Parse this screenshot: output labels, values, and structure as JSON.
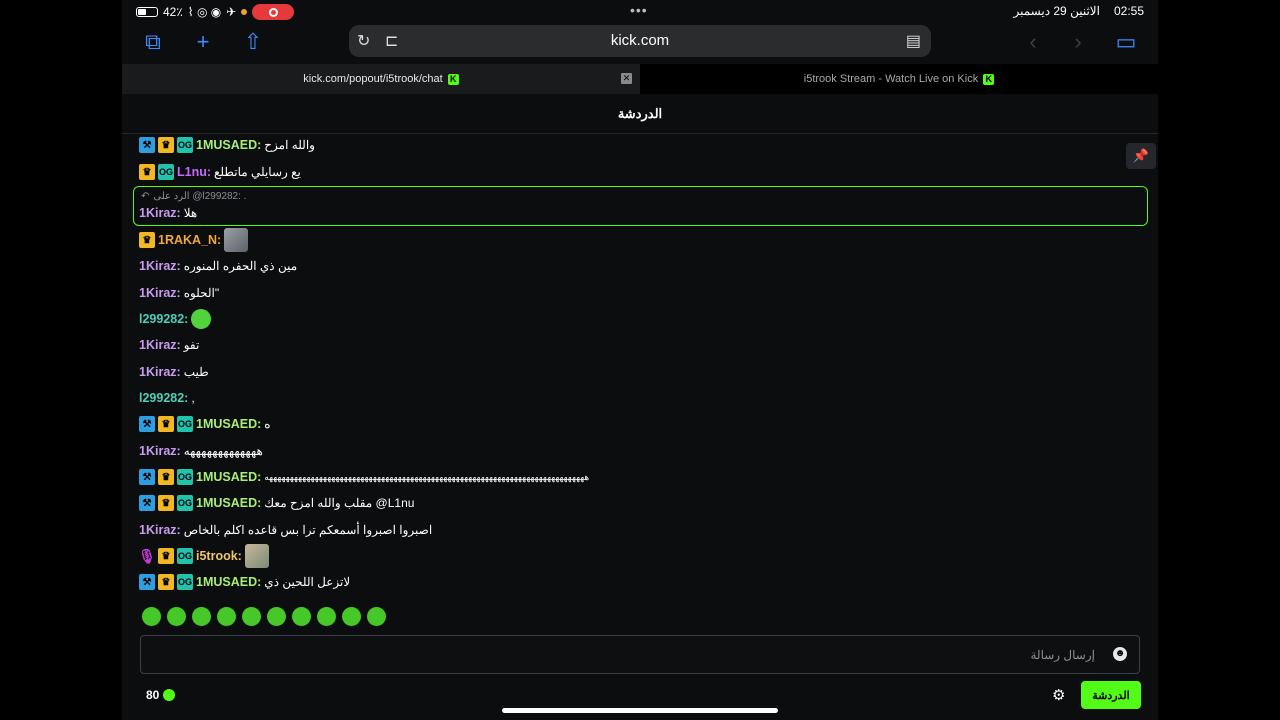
{
  "status": {
    "battery_pct": "42٪",
    "date": "الاثنين 29 ديسمبر",
    "time": "02:55"
  },
  "browser": {
    "url": "kick.com",
    "tabs": [
      {
        "label": "kick.com/popout/i5trook/chat",
        "close": "✕"
      },
      {
        "label": "i5trook Stream - Watch Live on Kick"
      }
    ]
  },
  "chat": {
    "title": "الدردشة",
    "reply_ref": "الرد على @l299282: .",
    "messages": [
      {
        "user": "1MUSAED:",
        "user_color": "#a8ef77",
        "text": "والله امزح"
      },
      {
        "user": "L1nu:",
        "user_color": "#c36bff",
        "text": "يع رسايلي ماتطلع"
      },
      {
        "user": "1Kiraz:",
        "user_color": "#c89bf0",
        "text": "هلا"
      },
      {
        "user": "1RAKA_N:",
        "user_color": "#f0a73c",
        "text": ""
      },
      {
        "user": "1Kiraz:",
        "user_color": "#c89bf0",
        "text": "مين ذي الحفره المنوره"
      },
      {
        "user": "1Kiraz:",
        "user_color": "#c89bf0",
        "text": "الحلوه\""
      },
      {
        "user": "l299282:",
        "user_color": "#4ed0b8",
        "text": ""
      },
      {
        "user": "1Kiraz:",
        "user_color": "#c89bf0",
        "text": "تفو"
      },
      {
        "user": "1Kiraz:",
        "user_color": "#c89bf0",
        "text": "طيب"
      },
      {
        "user": "l299282:",
        "user_color": "#4ed0b8",
        "text": ","
      },
      {
        "user": "1MUSAED:",
        "user_color": "#a8ef77",
        "text": "ه"
      },
      {
        "user": "1Kiraz:",
        "user_color": "#c89bf0",
        "text": "هههههههههههههه"
      },
      {
        "user": "1MUSAED:",
        "user_color": "#a8ef77",
        "text": "هههههههههههههههههههههههههههههههههههههههههههههههههههههههههههههههههههههههههههههه"
      },
      {
        "user": "1MUSAED:",
        "user_color": "#a8ef77",
        "text": "مقلب والله امزح معك @L1nu"
      },
      {
        "user": "1Kiraz:",
        "user_color": "#c89bf0",
        "text": "اصبروا اصبروا أسمعكم ترا بس قاعده اكلم بالخاص"
      },
      {
        "user": "i5trook:",
        "user_color": "#f0c66b",
        "text": ""
      },
      {
        "user": "1MUSAED:",
        "user_color": "#a8ef77",
        "text": "لاتزعل اللحين ذي"
      }
    ],
    "input_placeholder": "إرسال رسالة",
    "viewers": "80",
    "chat_button": "الدردشة"
  },
  "icons": {
    "mod": "hammer-icon",
    "vip": "crown-icon",
    "og": "og-badge-icon",
    "pin": "📌"
  },
  "colors": {
    "accent": "#53fc18"
  }
}
